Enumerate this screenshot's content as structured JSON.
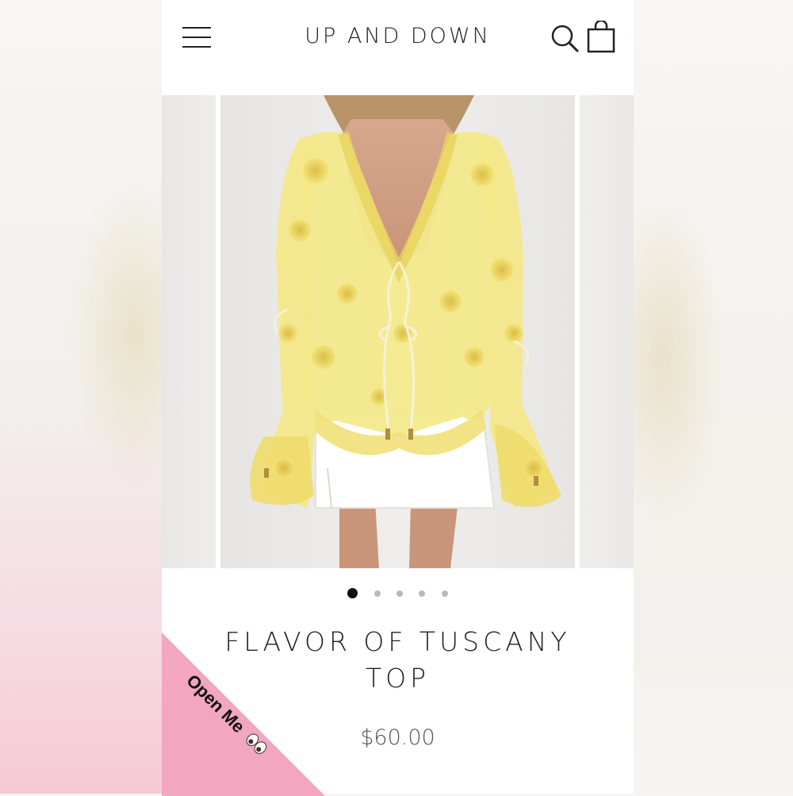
{
  "store": {
    "name": "UP AND DOWN"
  },
  "header": {
    "menu_icon": "hamburger-menu-icon",
    "search_icon": "search-icon",
    "cart_icon": "shopping-bag-icon"
  },
  "gallery": {
    "slide_count": 5,
    "active_slide": 1,
    "zoom_icon": "zoom-icon"
  },
  "product": {
    "title": "FLAVOR OF TUSCANY TOP",
    "price": "$60.00"
  },
  "badge": {
    "label": "Open Me",
    "emoji": "eyes-icon",
    "color": "#f2a6bf"
  },
  "colors": {
    "accent_dark": "#111111",
    "text": "#222222",
    "dot_inactive": "#b9b9b9"
  }
}
